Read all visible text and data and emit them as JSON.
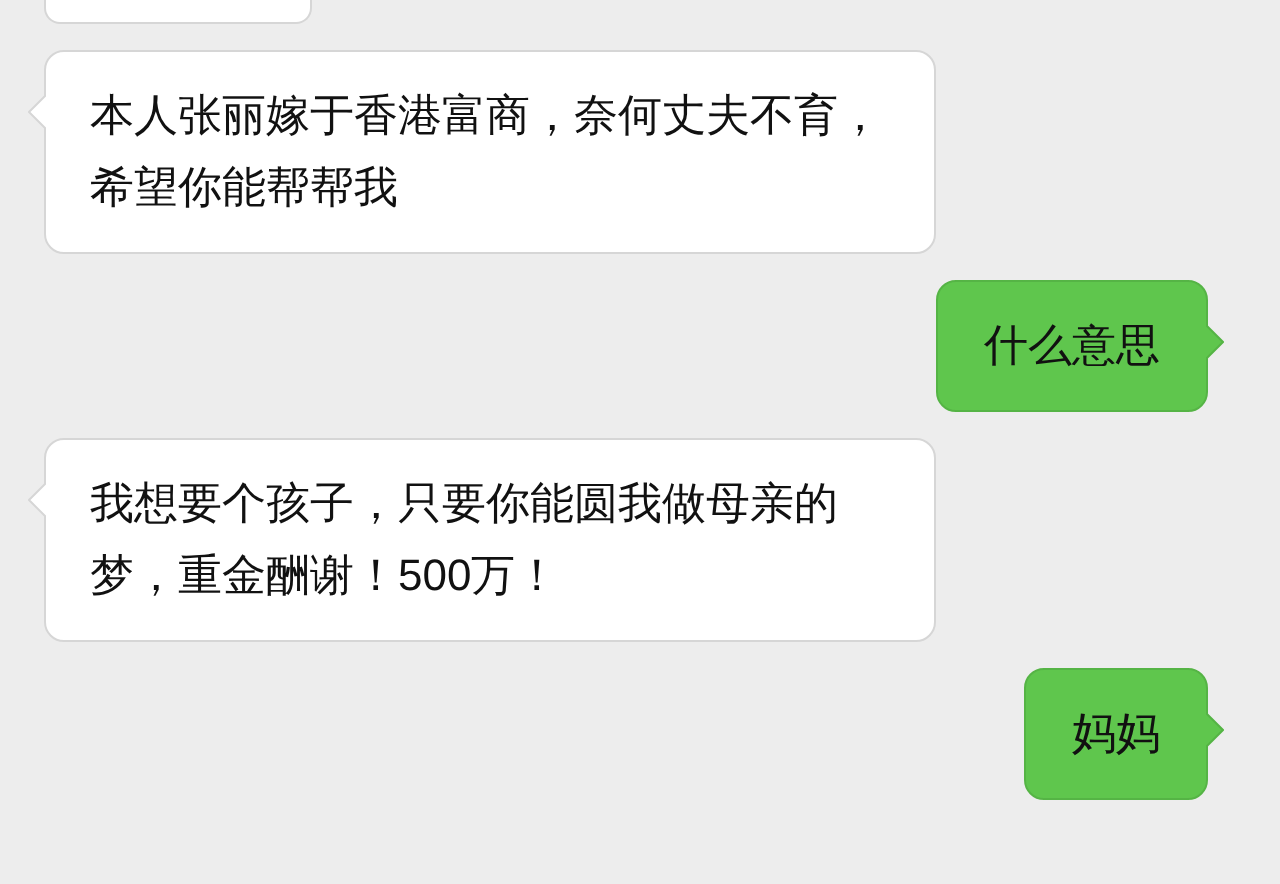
{
  "messages": [
    {
      "kind": "incoming_cut"
    },
    {
      "kind": "incoming",
      "lines": [
        "本人张丽嫁于香港富商，奈何丈夫不育，",
        "希望你能帮帮我"
      ]
    },
    {
      "kind": "outgoing",
      "lines": [
        "什么意思"
      ]
    },
    {
      "kind": "incoming",
      "lines": [
        "我想要个孩子，只要你能圆我做母亲的",
        "梦，重金酬谢！500万！"
      ]
    },
    {
      "kind": "outgoing",
      "lines": [
        "妈妈"
      ]
    }
  ]
}
